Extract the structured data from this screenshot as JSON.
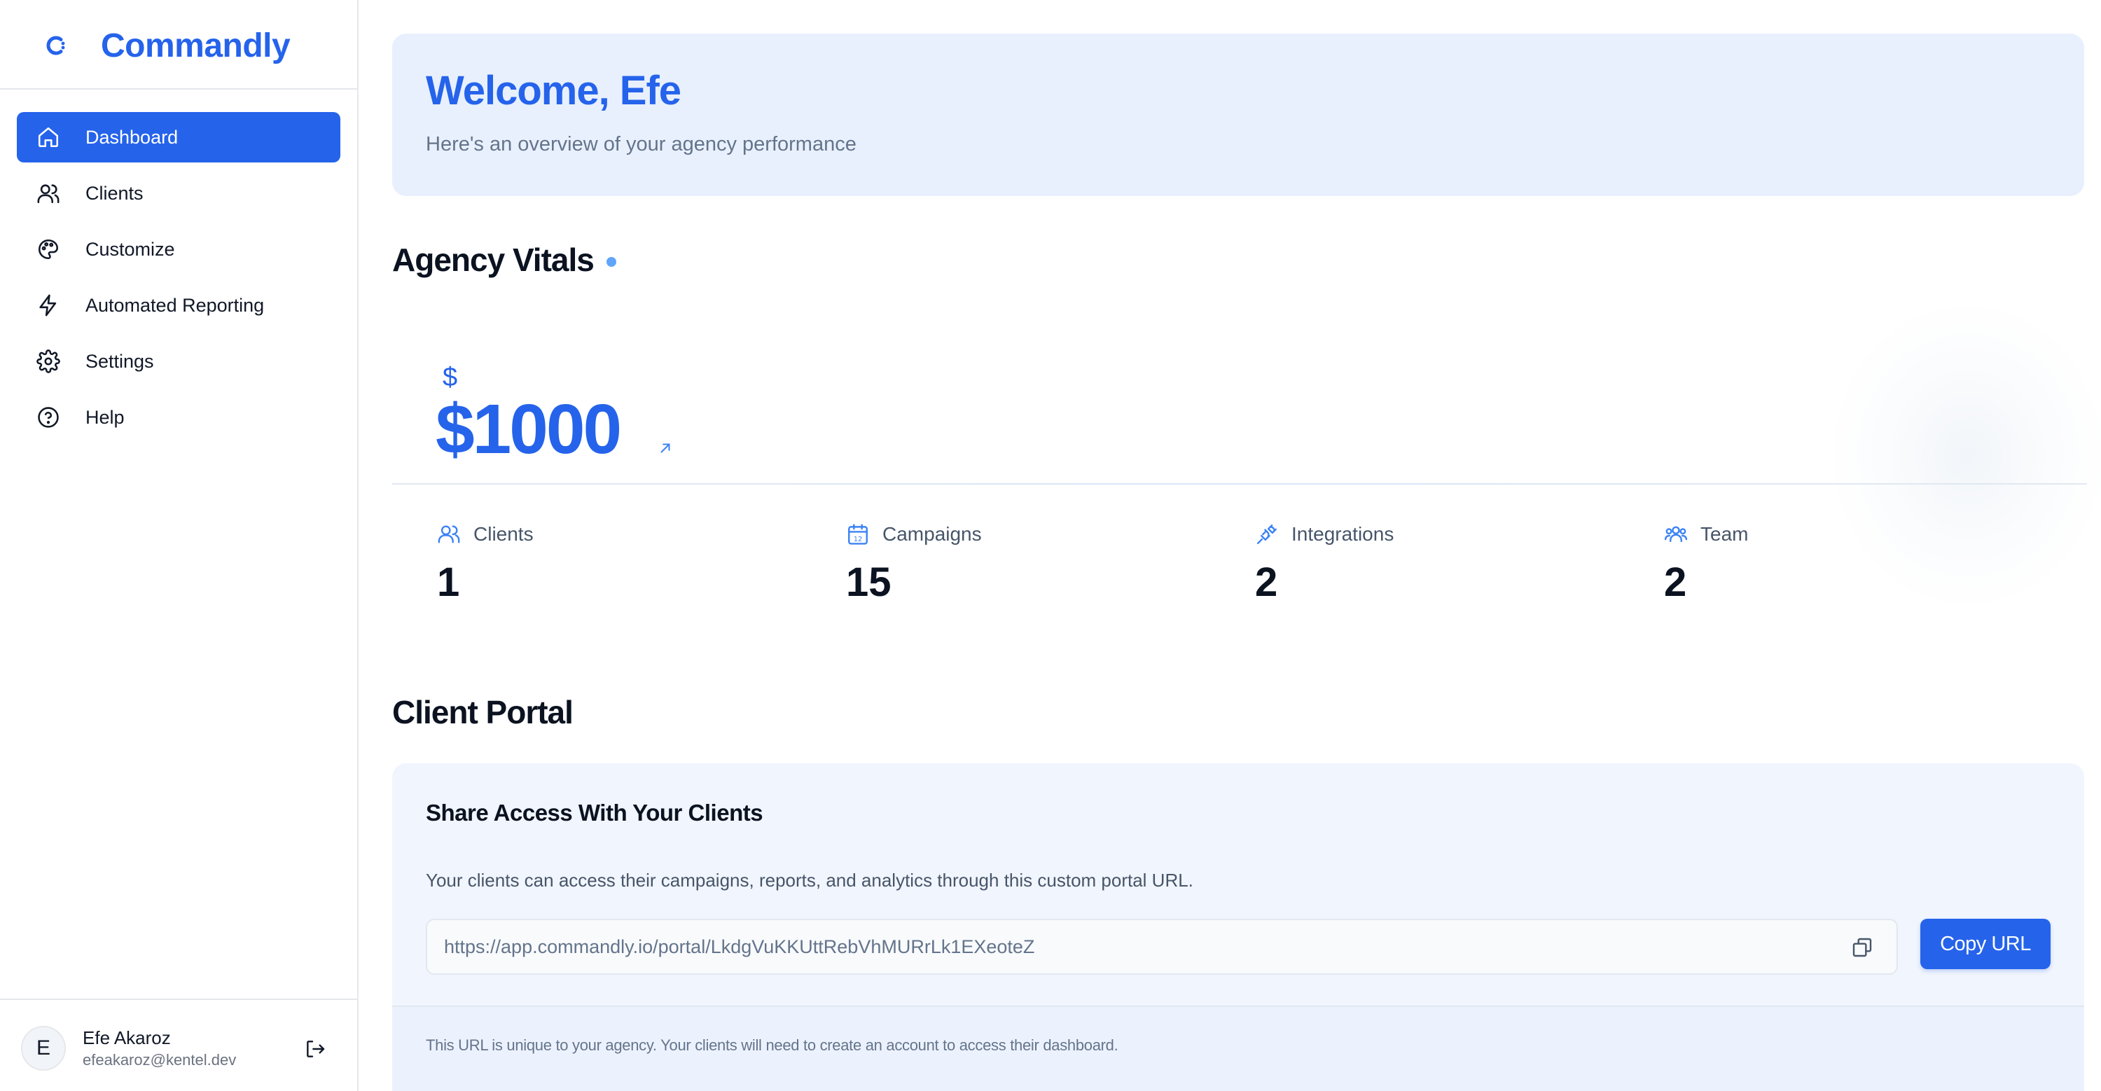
{
  "brand": {
    "name": "Commandly",
    "logo_icon": "commandly-logo"
  },
  "sidebar": {
    "items": [
      {
        "label": "Dashboard",
        "icon": "home-icon",
        "active": true
      },
      {
        "label": "Clients",
        "icon": "users-icon",
        "active": false
      },
      {
        "label": "Customize",
        "icon": "palette-icon",
        "active": false
      },
      {
        "label": "Automated Reporting",
        "icon": "lightning-icon",
        "active": false
      },
      {
        "label": "Settings",
        "icon": "gear-icon",
        "active": false
      },
      {
        "label": "Help",
        "icon": "help-circle-icon",
        "active": false
      }
    ]
  },
  "user": {
    "initial": "E",
    "name": "Efe Akaroz",
    "email": "efeakaroz@kentel.dev",
    "logout_icon": "logout-icon"
  },
  "welcome": {
    "title": "Welcome, Efe",
    "subtitle": "Here's an overview of your agency performance"
  },
  "vitals": {
    "title": "Agency Vitals",
    "currency_symbol": "$",
    "revenue": "$1000",
    "trend_icon": "arrow-up-right-icon",
    "stats": [
      {
        "label": "Clients",
        "value": "1",
        "icon": "users-icon"
      },
      {
        "label": "Campaigns",
        "value": "15",
        "icon": "calendar-icon"
      },
      {
        "label": "Integrations",
        "value": "2",
        "icon": "plug-icon"
      },
      {
        "label": "Team",
        "value": "2",
        "icon": "team-icon"
      }
    ]
  },
  "portal": {
    "section_title": "Client Portal",
    "card_title": "Share Access With Your Clients",
    "description": "Your clients can access their campaigns, reports, and analytics through this custom portal URL.",
    "url": "https://app.commandly.io/portal/LkdgVuKKUttRebVhMURrLk1EXeoteZ",
    "copy_button": "Copy URL",
    "copy_icon": "copy-icon",
    "note": "This URL is unique to your agency. Your clients will need to create an account to access their dashboard."
  },
  "colors": {
    "accent": "#2563eb",
    "welcome_bg": "#e8f0fd",
    "card_bg": "#f1f5fd"
  }
}
